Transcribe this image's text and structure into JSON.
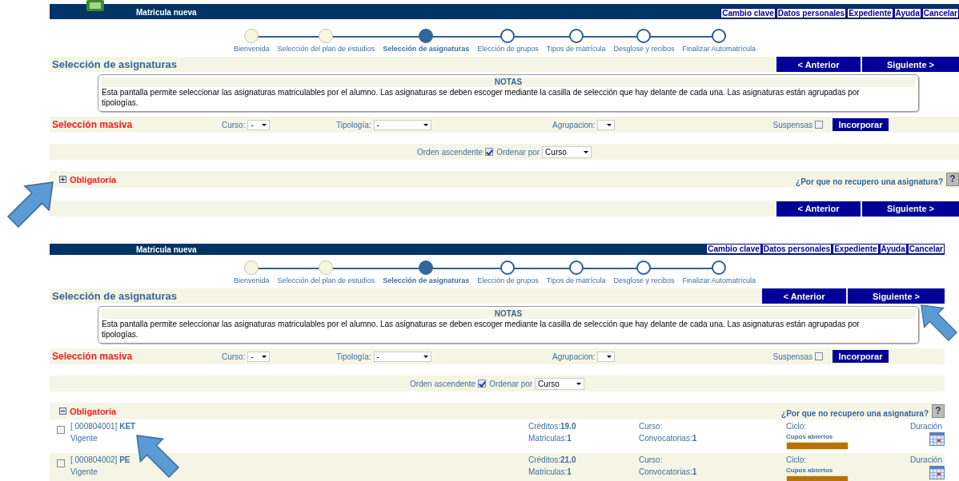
{
  "panels": [
    {
      "header": {
        "logo": true,
        "subtitle": "Matricula nueva",
        "links": [
          "Cambio clave",
          "Datos personales",
          "Expediente",
          "Ayuda",
          "Cancelar"
        ]
      },
      "steps": [
        {
          "label": "Bienvenida",
          "completed": true,
          "selected": false
        },
        {
          "label": "Selección del plan de estudios",
          "completed": true,
          "selected": false
        },
        {
          "label": "Selección de asignaturas",
          "completed": false,
          "selected": true
        },
        {
          "label": "Elección de grupos",
          "completed": false,
          "selected": false
        },
        {
          "label": "Tipos de matrícula",
          "completed": false,
          "selected": false
        },
        {
          "label": "Desglose y recibos",
          "completed": false,
          "selected": false
        },
        {
          "label": "Finalizar Automatrícula",
          "completed": false,
          "selected": false
        }
      ],
      "title": "Selección de asignaturas",
      "nav_buttons": [
        "< Anterior",
        "Siguiente >"
      ],
      "notes": {
        "heading": "NOTAS",
        "text": "Esta pantalla permite seleccionar las asignaturas matriculables por el alumno. Las asignaturas se deben escoger mediante la casilla de selección que hay delante de cada una. Las asignaturas están agrupadas por tipologías."
      },
      "mass": {
        "label": "Selección masiva",
        "curso_label": "Curso:",
        "curso": "-",
        "tipologia_label": "Tipología:",
        "tipologia": "-",
        "agrupacion_label": "Agrupacion:",
        "suspensas_label": "Suspensas",
        "suspensas_checked": false,
        "button": "Incorporar"
      },
      "order": {
        "label": "Orden ascendente",
        "checked": true,
        "sort_label": "Ordenar por",
        "sort": "Curso"
      },
      "group": {
        "name": "Obligatoria",
        "expanded": false,
        "help": "¿Por que no recupero una asignatura?",
        "help_icon": "?"
      },
      "bottom_buttons": [
        "< Anterior",
        "Siguiente >"
      ]
    },
    {
      "header": {
        "logo": false,
        "subtitle": "Matricula nueva",
        "links": [
          "Cambio clave",
          "Datos personales",
          "Expediente",
          "Ayuda",
          "Cancelar"
        ]
      },
      "steps": [
        {
          "label": "Bienvenida",
          "completed": true,
          "selected": false
        },
        {
          "label": "Selección del plan de estudios",
          "completed": true,
          "selected": false
        },
        {
          "label": "Selección de asignaturas",
          "completed": false,
          "selected": true
        },
        {
          "label": "Elección de grupos",
          "completed": false,
          "selected": false
        },
        {
          "label": "Tipos de matrícula",
          "completed": false,
          "selected": false
        },
        {
          "label": "Desglose y recibos",
          "completed": false,
          "selected": false
        },
        {
          "label": "Finalizar Automatrícula",
          "completed": false,
          "selected": false
        }
      ],
      "title": "Selección de asignaturas",
      "nav_buttons": [
        "< Anterior",
        "Siguiente >"
      ],
      "notes": {
        "heading": "NOTAS",
        "text": "Esta pantalla permite seleccionar las asignaturas matriculables por el alumno. Las asignaturas se deben escoger mediante la casilla de selección que hay delante de cada una. Las asignaturas están agrupadas por tipologías."
      },
      "mass": {
        "label": "Selección masiva",
        "curso_label": "Curso:",
        "curso": "-",
        "tipologia_label": "Tipología:",
        "tipologia": "-",
        "agrupacion_label": "Agrupacion:",
        "suspensas_label": "Suspensas",
        "suspensas_checked": false,
        "button": "Incorporar"
      },
      "order": {
        "label": "Orden ascendente",
        "checked": true,
        "sort_label": "Ordenar por",
        "sort": "Curso"
      },
      "group": {
        "name": "Obligatoria",
        "expanded": true,
        "help": "¿Por que no recupero una asignatura?",
        "help_icon": "?"
      },
      "subjects": [
        {
          "code": "[ 000804001]",
          "name": "KET",
          "status": "Vigente",
          "checked": false,
          "creditos_label": "Créditos:",
          "creditos": "19.0",
          "matriculas_label": "Matriculas:",
          "matriculas": "1",
          "curso_label": "Curso:",
          "convocatorias_label": "Convocatorias:",
          "convocatorias": "1",
          "ciclo_label": "Ciclo:",
          "cupos": "Cupos abiertos",
          "level": 1,
          "duracion": "Duración"
        },
        {
          "code": "[ 000804002]",
          "name": "PE",
          "status": "Vigente",
          "checked": false,
          "creditos_label": "Créditos:",
          "creditos": "21.0",
          "matriculas_label": "Matriculas:",
          "matriculas": "1",
          "curso_label": "Curso:",
          "convocatorias_label": "Convocatorias:",
          "convocatorias": "1",
          "ciclo_label": "Ciclo:",
          "cupos": "Cupos abiertos",
          "level": 1,
          "duracion": "Duración"
        }
      ]
    }
  ]
}
